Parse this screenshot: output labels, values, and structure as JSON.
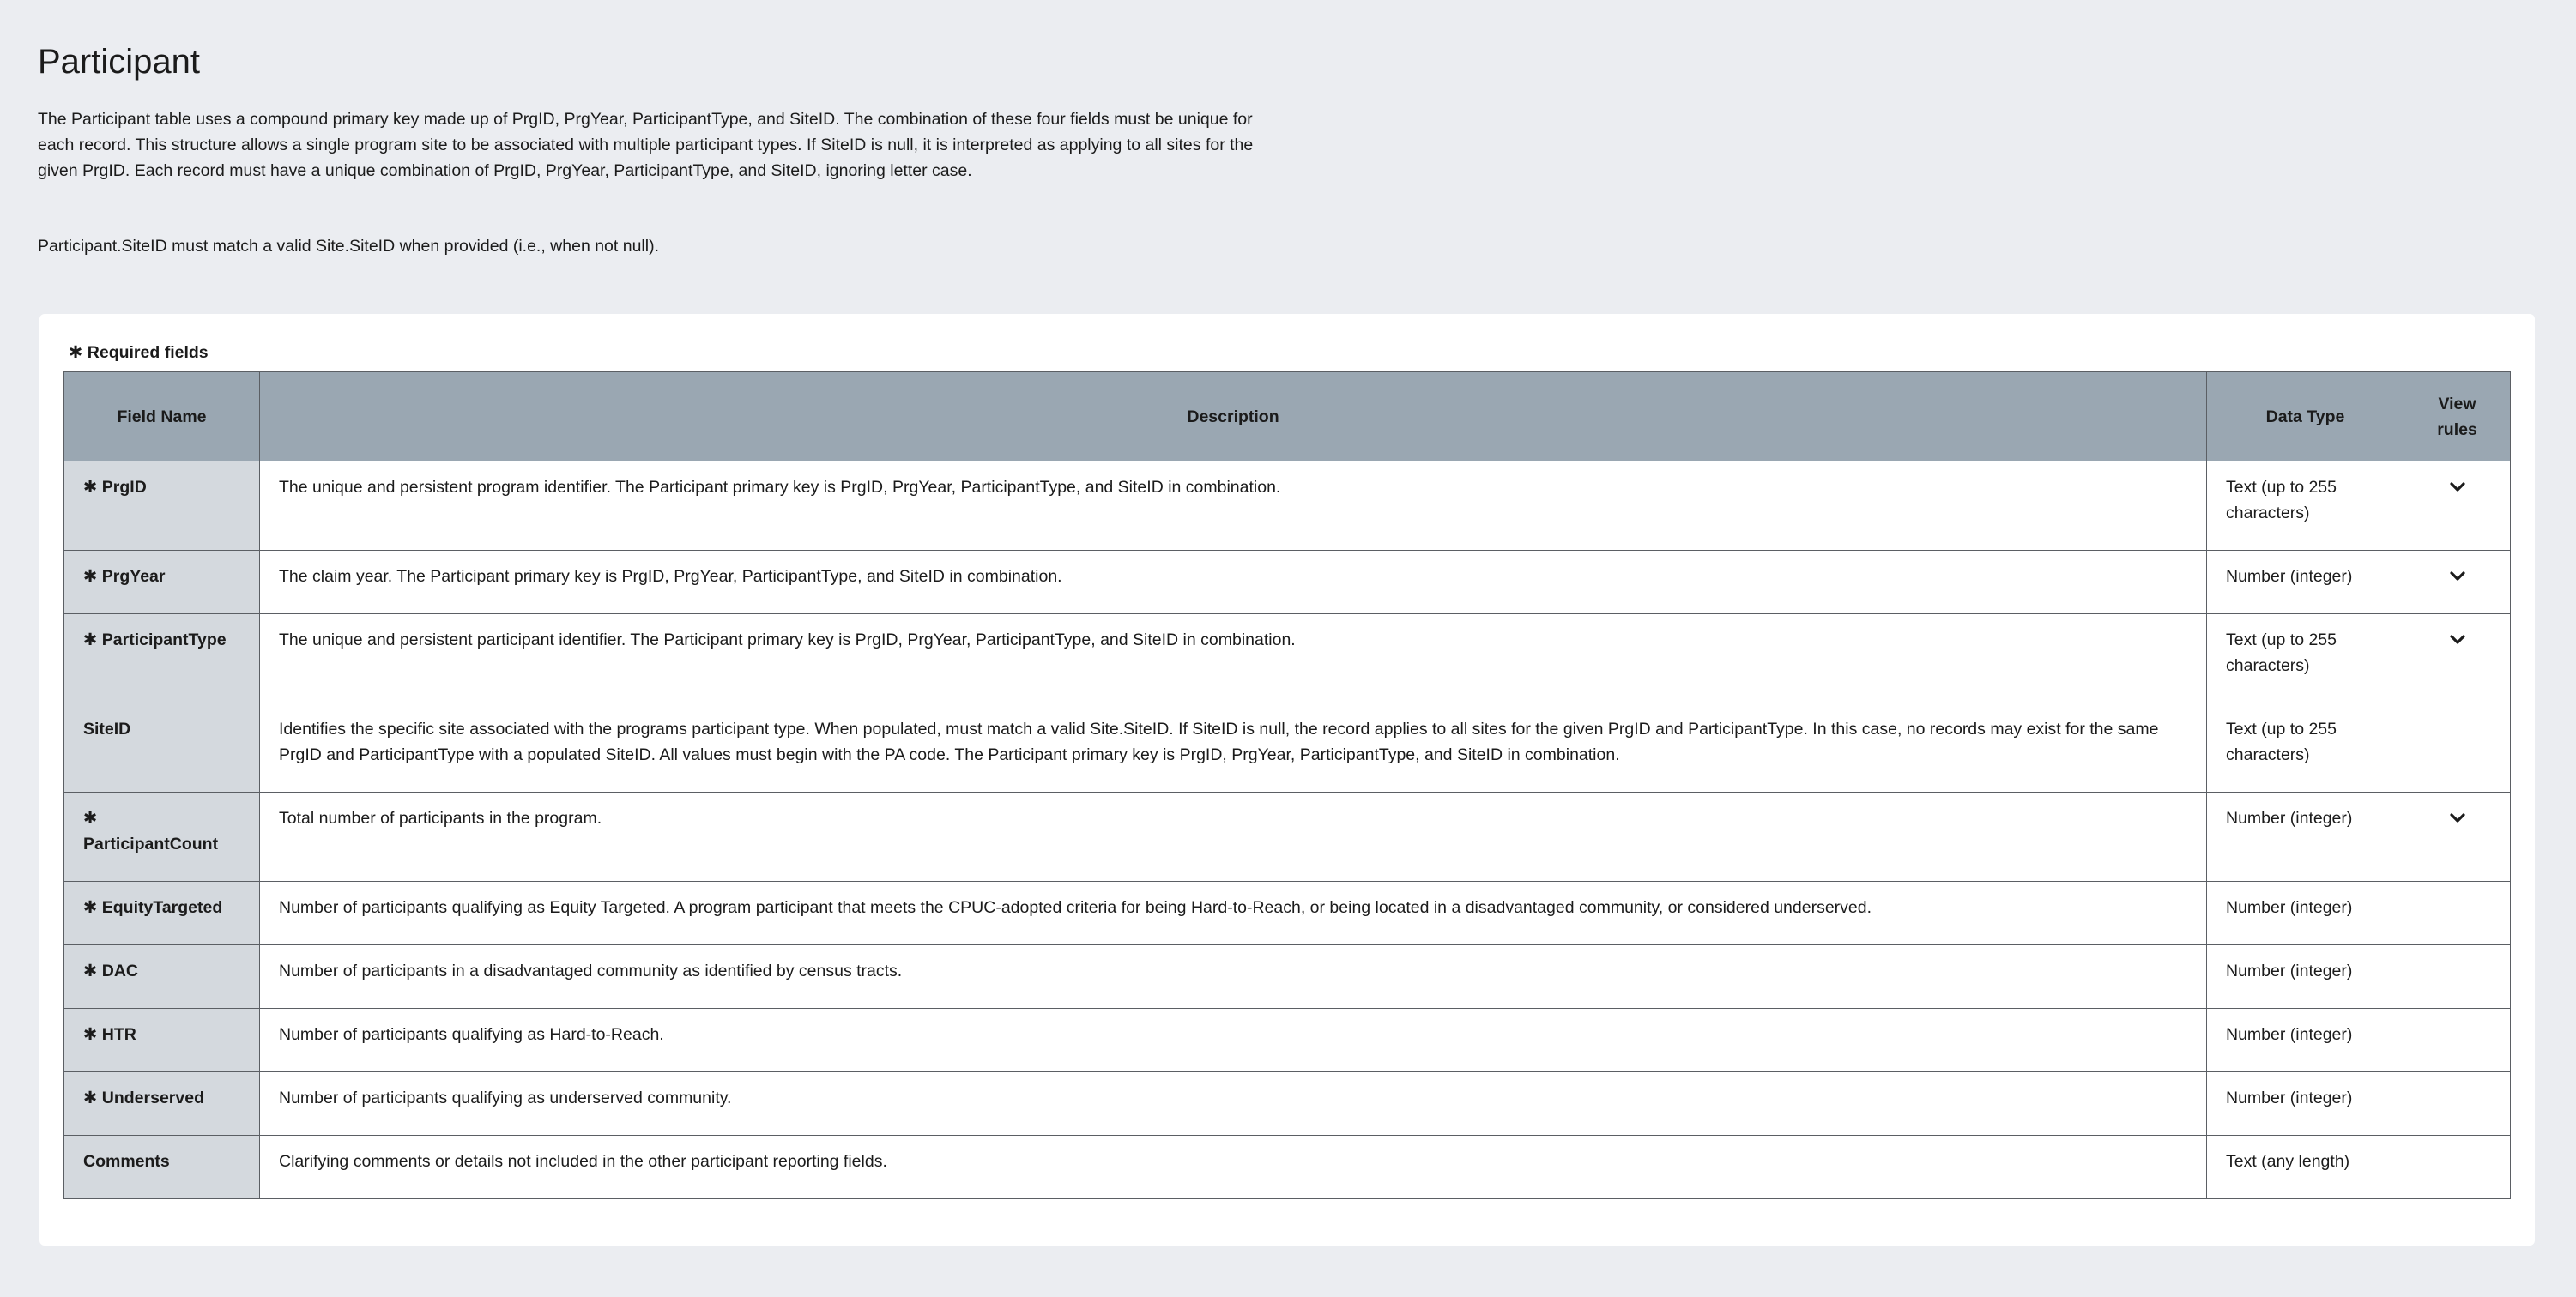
{
  "page": {
    "title": "Participant",
    "intro": "The Participant table uses a compound primary key made up of PrgID, PrgYear, ParticipantType, and SiteID. The combination of these four fields must be unique for each record. This structure allows a single program site to be associated with multiple participant types. If SiteID is null, it is interpreted as applying to all sites for the given PrgID. Each record must have a unique combination of PrgID, PrgYear, ParticipantType, and SiteID, ignoring letter case.",
    "fk_note": "Participant.SiteID must match a valid Site.SiteID when provided (i.e., when not null)."
  },
  "legend": {
    "star": "✱",
    "label": "Required fields"
  },
  "table": {
    "headers": {
      "field_name": "Field Name",
      "description": "Description",
      "data_type": "Data Type",
      "view_rules_line1": "View",
      "view_rules_line2": "rules"
    },
    "rows": [
      {
        "star": "✱",
        "name": "PrgID",
        "description": "The unique and persistent program identifier. The Participant primary key is PrgID, PrgYear, ParticipantType, and SiteID in combination.",
        "data_type": "Text (up to 255 characters)",
        "has_rules": true
      },
      {
        "star": "✱",
        "name": "PrgYear",
        "description": "The claim year. The Participant primary key is PrgID, PrgYear, ParticipantType, and SiteID in combination.",
        "data_type": "Number (integer)",
        "has_rules": true
      },
      {
        "star": "✱",
        "name": "ParticipantType",
        "description": "The unique and persistent participant identifier. The Participant primary key is PrgID, PrgYear, ParticipantType, and SiteID in combination.",
        "data_type": "Text (up to 255 characters)",
        "has_rules": true
      },
      {
        "star": "",
        "name": "SiteID",
        "description": "Identifies the specific site associated with the programs participant type. When populated, must match a valid Site.SiteID. If SiteID is null, the record applies to all sites for the given PrgID and ParticipantType. In this case, no records may exist for the same PrgID and ParticipantType with a populated SiteID. All values must begin with the PA code. The Participant primary key is PrgID, PrgYear, ParticipantType, and SiteID in combination.",
        "data_type": "Text (up to 255 characters)",
        "has_rules": false
      },
      {
        "star": "✱",
        "name": "ParticipantCount",
        "description": "Total number of participants in the program.",
        "data_type": "Number (integer)",
        "has_rules": true
      },
      {
        "star": "✱",
        "name": "EquityTargeted",
        "description": "Number of participants qualifying as Equity Targeted. A program participant that meets the CPUC-adopted criteria for being Hard-to-Reach, or being located in a disadvantaged community, or considered underserved.",
        "data_type": "Number (integer)",
        "has_rules": false
      },
      {
        "star": "✱",
        "name": "DAC",
        "description": "Number of participants in a disadvantaged community as identified by census tracts.",
        "data_type": "Number (integer)",
        "has_rules": false
      },
      {
        "star": "✱",
        "name": "HTR",
        "description": "Number of participants qualifying as Hard-to-Reach.",
        "data_type": "Number (integer)",
        "has_rules": false
      },
      {
        "star": "✱",
        "name": "Underserved",
        "description": "Number of participants qualifying as underserved community.",
        "data_type": "Number (integer)",
        "has_rules": false
      },
      {
        "star": "",
        "name": "Comments",
        "description": "Clarifying comments or details not included in the other participant reporting fields.",
        "data_type": "Text (any length)",
        "has_rules": false
      }
    ]
  },
  "icons": {
    "expand": "chevron-down-icon"
  },
  "colors": {
    "page_bg": "#ebedf1",
    "header_bg": "#9aa7b2",
    "field_name_bg": "#d4d9de",
    "border": "#5b5f64"
  }
}
